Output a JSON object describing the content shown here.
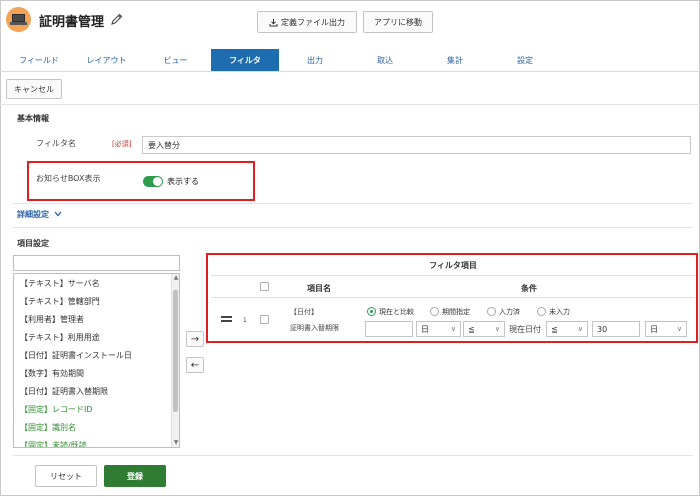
{
  "app": {
    "title": "証明書管理"
  },
  "toolbar": {
    "export_label": "定義ファイル出力",
    "goto_app_label": "アプリに移動",
    "cancel_label": "キャンセル"
  },
  "tabs": [
    {
      "label": "フィールド"
    },
    {
      "label": "レイアウト"
    },
    {
      "label": "ビュー"
    },
    {
      "label": "フィルタ"
    },
    {
      "label": "出力"
    },
    {
      "label": "取込"
    },
    {
      "label": "集計"
    },
    {
      "label": "設定"
    }
  ],
  "basic": {
    "section_title": "基本情報",
    "filter_name_label": "フィルタ名",
    "required_label": "[必須]",
    "filter_name_value": "要入替分",
    "notice_label": "お知らせBOX表示",
    "notice_toggle_label": "表示する"
  },
  "detail": {
    "label": "詳細設定"
  },
  "items": {
    "section_title": "項目設定",
    "fields": [
      {
        "label": "【テキスト】サーバ名",
        "green": false
      },
      {
        "label": "【テキスト】管轄部門",
        "green": false
      },
      {
        "label": "【利用者】管理者",
        "green": false
      },
      {
        "label": "【テキスト】利用用途",
        "green": false
      },
      {
        "label": "【日付】証明書インストール日",
        "green": false
      },
      {
        "label": "【数字】有効期間",
        "green": false
      },
      {
        "label": "【日付】証明書入替期限",
        "green": false
      },
      {
        "label": "【固定】レコードID",
        "green": true
      },
      {
        "label": "【固定】識別名",
        "green": true
      },
      {
        "label": "【固定】未読/既読",
        "green": true
      }
    ]
  },
  "filter": {
    "title": "フィルタ項目",
    "col_name": "項目名",
    "col_condition": "条件",
    "row": {
      "index": "1",
      "field_type": "【日付】",
      "field_name": "証明書入替期限",
      "radios": [
        {
          "label": "現在と比較",
          "selected": true
        },
        {
          "label": "期間指定",
          "selected": false
        },
        {
          "label": "入力済",
          "selected": false
        },
        {
          "label": "未入力",
          "selected": false
        }
      ],
      "unit1": "日",
      "op1": "≦",
      "current_date_label": "現在日付",
      "op2": "≦",
      "days_value": "30",
      "unit2": "日"
    }
  },
  "footer": {
    "reset_label": "リセット",
    "register_label": "登録"
  },
  "colors": {
    "accent": "#1d6db0",
    "toggle_on": "#2d9c4e",
    "register": "#2f7d32",
    "highlight": "#e01e1e",
    "fixed_field": "#2e8b2e"
  }
}
